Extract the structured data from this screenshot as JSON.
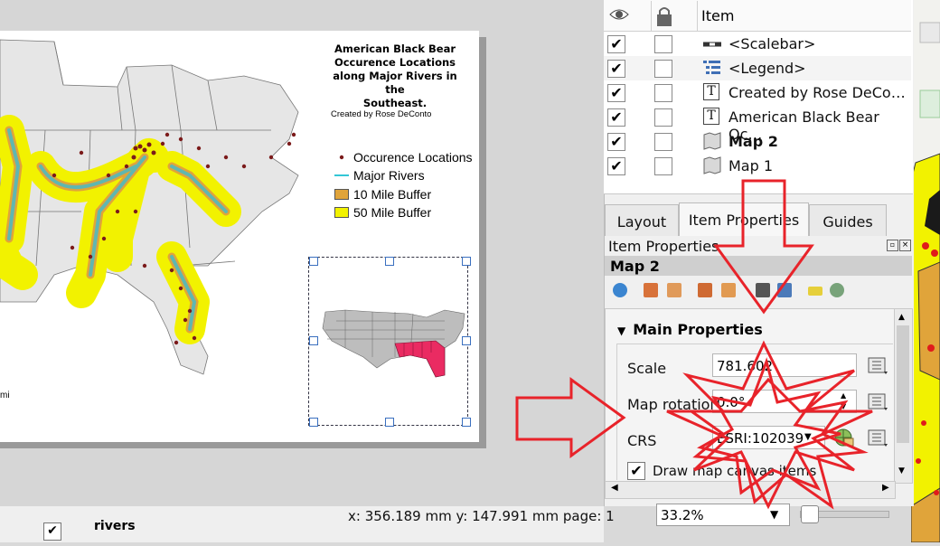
{
  "map": {
    "title_lines": [
      "American Black Bear",
      "Occurence Locations",
      "along Major Rivers in the",
      "Southeast."
    ],
    "credit": "Created by Rose DeConto",
    "left_label": "mi",
    "legend": [
      {
        "label": "Occurence Locations",
        "symbol": "dot",
        "color": "#7b1a1a"
      },
      {
        "label": "Major Rivers",
        "symbol": "line",
        "color": "#33c7d6"
      },
      {
        "label": "10 Mile Buffer",
        "symbol": "box",
        "color": "#e0a43a"
      },
      {
        "label": "50 Mile Buffer",
        "symbol": "box",
        "color": "#f2f200"
      }
    ],
    "colors": {
      "buffer_50": "#f2f200",
      "buffer_10": "#e0a43a",
      "river": "#5fb7b0",
      "state_fill": "#e6e6e6",
      "highlight": "#ea2b62"
    }
  },
  "items_panel": {
    "header": {
      "item": "Item",
      "visibility_icon": "eye-icon",
      "lock_icon": "lock-icon"
    },
    "rows": [
      {
        "label": "<Scalebar>",
        "checked": true,
        "bold": false,
        "icon": "scalebar-icon"
      },
      {
        "label": "<Legend>",
        "checked": true,
        "bold": false,
        "icon": "legend-icon"
      },
      {
        "label": "Created by Rose DeCo…",
        "checked": true,
        "bold": false,
        "icon": "text-icon"
      },
      {
        "label": "American Black Bear Oc…",
        "checked": true,
        "bold": false,
        "icon": "text-icon"
      },
      {
        "label": "Map 2",
        "checked": true,
        "bold": true,
        "icon": "map-icon"
      },
      {
        "label": "Map 1",
        "checked": true,
        "bold": false,
        "icon": "map-icon"
      }
    ]
  },
  "tabs": [
    "Layout",
    "Item Properties",
    "Guides"
  ],
  "item_properties": {
    "title": "Item Properties",
    "item_name": "Map 2",
    "section": "Main Properties",
    "scale_label": "Scale",
    "scale_value": "781.602",
    "rotation_label": "Map rotation",
    "rotation_value": "0.0°",
    "crs_label": "CRS",
    "crs_value": "ESRI:102039",
    "draw_label": "Draw map canvas items",
    "draw_checked": true
  },
  "status": {
    "coords": "x: 356.189 mm y: 147.991 mm page: 1",
    "zoom": "33.2%",
    "left_text": "rivers"
  },
  "annotations": {
    "color": "#e8232a"
  }
}
